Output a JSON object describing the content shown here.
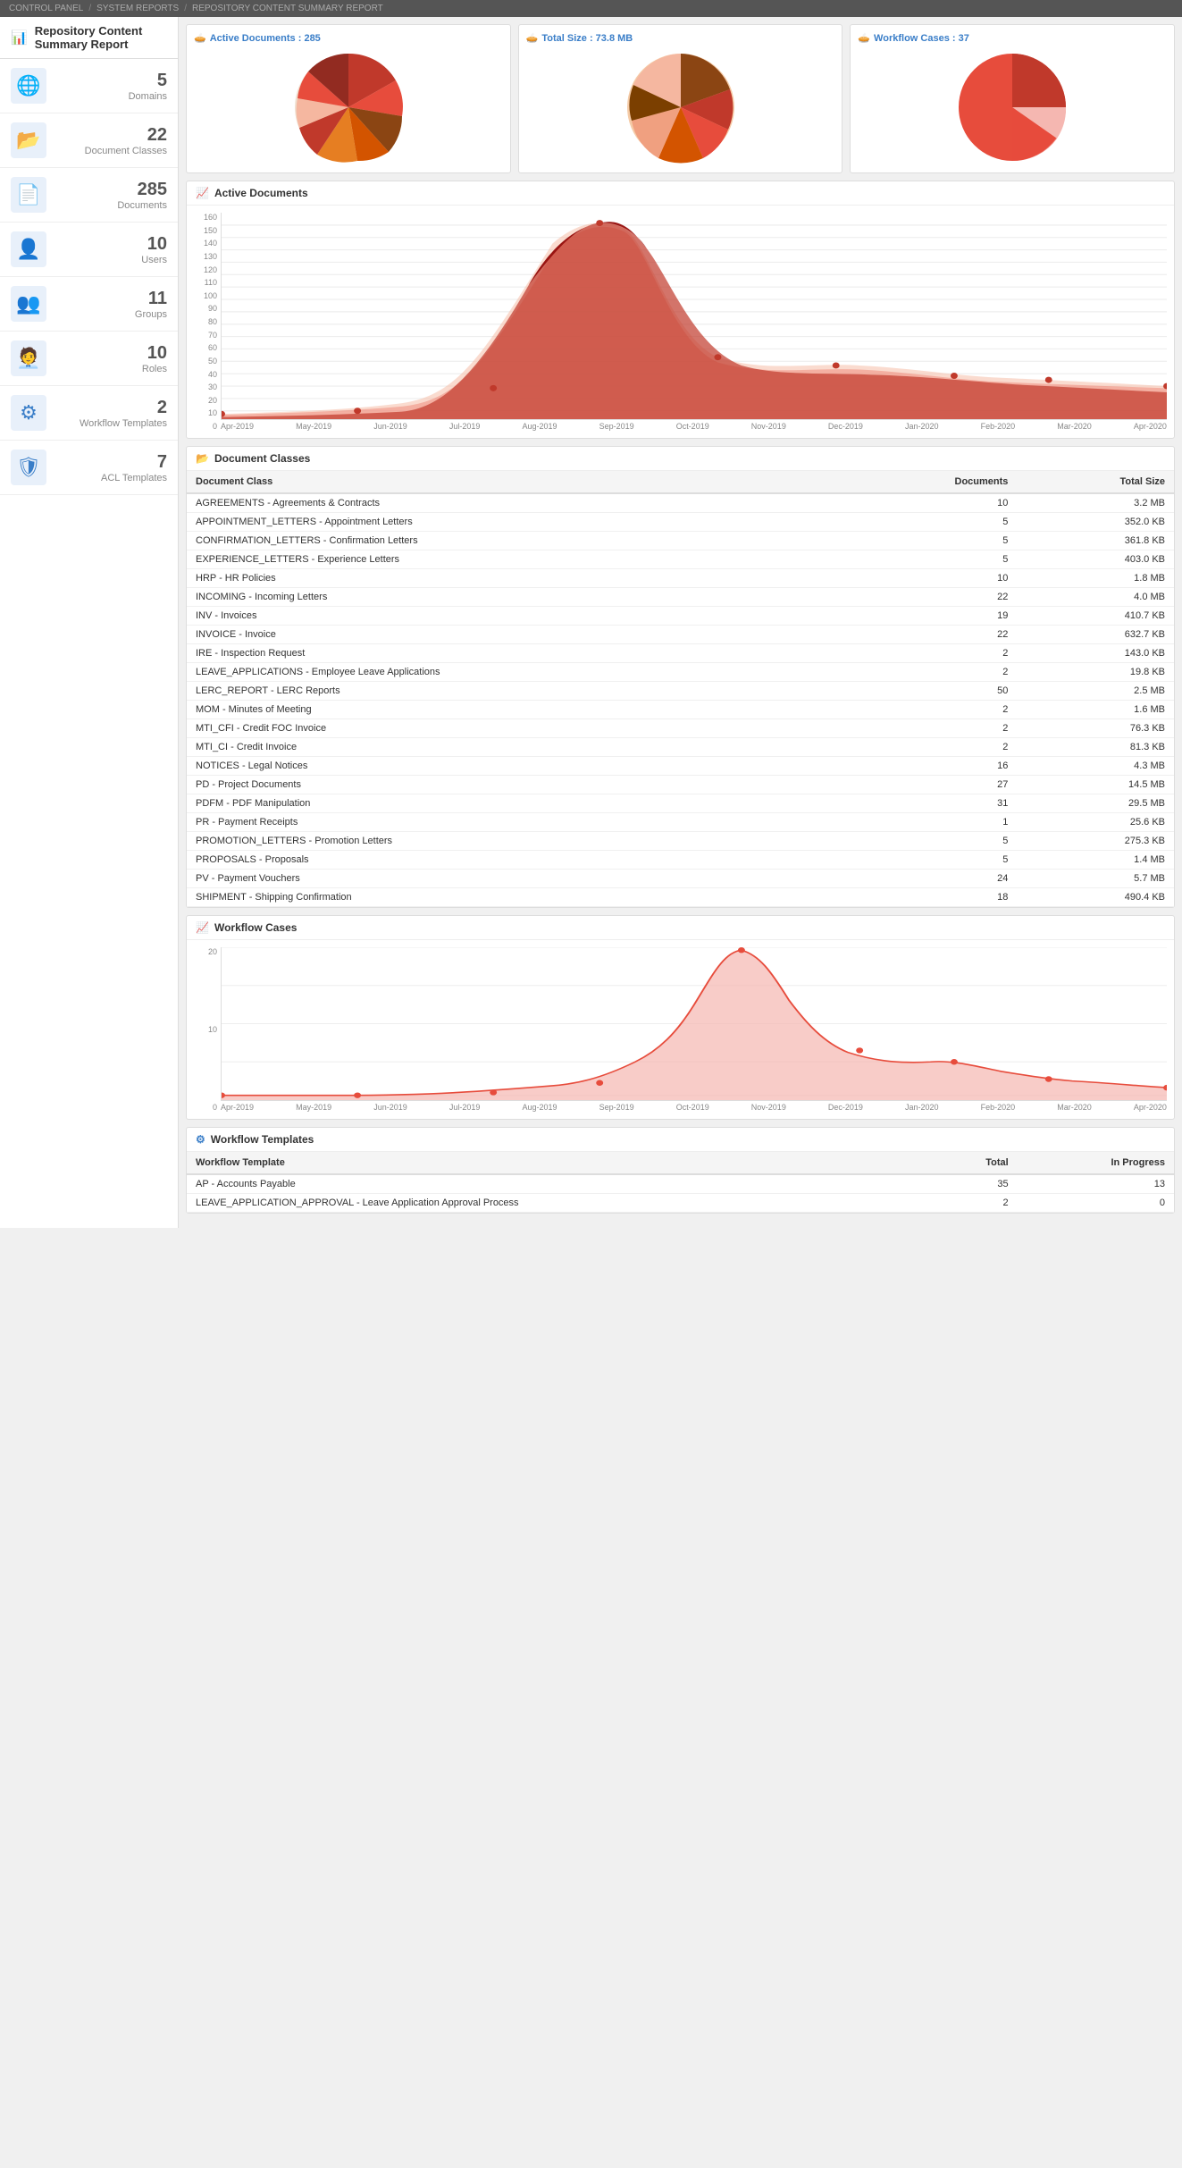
{
  "breadcrumb": {
    "items": [
      "CONTROL PANEL",
      "SYSTEM REPORTS",
      "REPOSITORY CONTENT SUMMARY REPORT"
    ]
  },
  "page_title": "Repository Content Summary Report",
  "sidebar": {
    "stats": [
      {
        "id": "domains",
        "icon": "🌐",
        "number": "5",
        "label": "Domains"
      },
      {
        "id": "document-classes",
        "icon": "📂",
        "number": "22",
        "label": "Document Classes"
      },
      {
        "id": "documents",
        "icon": "📄",
        "number": "285",
        "label": "Documents"
      },
      {
        "id": "users",
        "icon": "👤",
        "number": "10",
        "label": "Users"
      },
      {
        "id": "groups",
        "icon": "👥",
        "number": "11",
        "label": "Groups"
      },
      {
        "id": "roles",
        "icon": "🧑‍💼",
        "number": "10",
        "label": "Roles"
      },
      {
        "id": "workflow-templates",
        "icon": "⚙",
        "number": "2",
        "label": "Workflow Templates"
      },
      {
        "id": "acl-templates",
        "icon": "🛡",
        "number": "7",
        "label": "ACL Templates"
      }
    ]
  },
  "summary_cards": [
    {
      "id": "active-docs",
      "title": "Active Documents : 285"
    },
    {
      "id": "total-size",
      "title": "Total Size : 73.8 MB"
    },
    {
      "id": "workflow-cases",
      "title": "Workflow Cases : 37"
    }
  ],
  "active_documents_chart": {
    "title": "Active Documents",
    "y_labels": [
      "160",
      "150",
      "140",
      "130",
      "120",
      "110",
      "100",
      "90",
      "80",
      "70",
      "60",
      "50",
      "40",
      "30",
      "20",
      "10",
      "0"
    ],
    "x_labels": [
      "Apr-2019",
      "May-2019",
      "Jun-2019",
      "Jul-2019",
      "Aug-2019",
      "Sep-2019",
      "Oct-2019",
      "Nov-2019",
      "Dec-2019",
      "Jan-2020",
      "Feb-2020",
      "Mar-2020",
      "Apr-2020"
    ]
  },
  "document_classes_table": {
    "title": "Document Classes",
    "headers": [
      "Document Class",
      "Documents",
      "Total Size"
    ],
    "rows": [
      [
        "AGREEMENTS - Agreements & Contracts",
        "10",
        "3.2 MB"
      ],
      [
        "APPOINTMENT_LETTERS - Appointment Letters",
        "5",
        "352.0 KB"
      ],
      [
        "CONFIRMATION_LETTERS - Confirmation Letters",
        "5",
        "361.8 KB"
      ],
      [
        "EXPERIENCE_LETTERS - Experience Letters",
        "5",
        "403.0 KB"
      ],
      [
        "HRP - HR Policies",
        "10",
        "1.8 MB"
      ],
      [
        "INCOMING - Incoming Letters",
        "22",
        "4.0 MB"
      ],
      [
        "INV - Invoices",
        "19",
        "410.7 KB"
      ],
      [
        "INVOICE - Invoice",
        "22",
        "632.7 KB"
      ],
      [
        "IRE - Inspection Request",
        "2",
        "143.0 KB"
      ],
      [
        "LEAVE_APPLICATIONS - Employee Leave Applications",
        "2",
        "19.8 KB"
      ],
      [
        "LERC_REPORT - LERC Reports",
        "50",
        "2.5 MB"
      ],
      [
        "MOM - Minutes of Meeting",
        "2",
        "1.6 MB"
      ],
      [
        "MTI_CFI - Credit FOC Invoice",
        "2",
        "76.3 KB"
      ],
      [
        "MTI_CI - Credit Invoice",
        "2",
        "81.3 KB"
      ],
      [
        "NOTICES - Legal Notices",
        "16",
        "4.3 MB"
      ],
      [
        "PD - Project Documents",
        "27",
        "14.5 MB"
      ],
      [
        "PDFM - PDF Manipulation",
        "31",
        "29.5 MB"
      ],
      [
        "PR - Payment Receipts",
        "1",
        "25.6 KB"
      ],
      [
        "PROMOTION_LETTERS - Promotion Letters",
        "5",
        "275.3 KB"
      ],
      [
        "PROPOSALS - Proposals",
        "5",
        "1.4 MB"
      ],
      [
        "PV - Payment Vouchers",
        "24",
        "5.7 MB"
      ],
      [
        "SHIPMENT - Shipping Confirmation",
        "18",
        "490.4 KB"
      ]
    ]
  },
  "workflow_cases_chart": {
    "title": "Workflow Cases",
    "y_labels": [
      "20",
      "",
      "10",
      "",
      "0"
    ],
    "x_labels": [
      "Apr-2019",
      "May-2019",
      "Jun-2019",
      "Jul-2019",
      "Aug-2019",
      "Sep-2019",
      "Oct-2019",
      "Nov-2019",
      "Dec-2019",
      "Jan-2020",
      "Feb-2020",
      "Mar-2020",
      "Apr-2020"
    ]
  },
  "workflow_templates_table": {
    "title": "Workflow Templates",
    "headers": [
      "Workflow Template",
      "Total",
      "In Progress"
    ],
    "rows": [
      [
        "AP - Accounts Payable",
        "35",
        "13"
      ],
      [
        "LEAVE_APPLICATION_APPROVAL - Leave Application Approval Process",
        "2",
        "0"
      ]
    ]
  }
}
